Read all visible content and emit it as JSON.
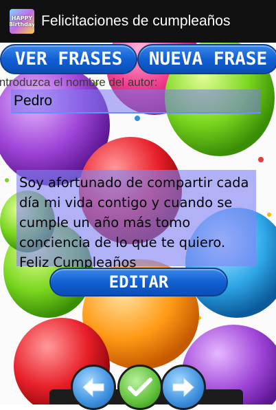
{
  "actionbar": {
    "title": "Felicitaciones de cumpleaños",
    "icon_text": "HAPPY Birthday"
  },
  "buttons": {
    "ver_frases": "VER FRASES",
    "nueva_frase": "NUEVA FRASE",
    "editar": "EDITAR"
  },
  "author": {
    "label": "Introduzca el nombre del autor:",
    "value": "Pedro"
  },
  "phrase": {
    "text": "Soy afortunado de compartir cada día mi vida contigo y cuando se cumple un año más tomo conciencia de lo que te quiero. Feliz Cumpleaños"
  },
  "nav": {
    "prev_icon": "arrow-left-icon",
    "ok_icon": "checkmark-icon",
    "next_icon": "arrow-right-icon"
  },
  "colors": {
    "button_blue": "#1160d3",
    "highlight_purple": "#8282f5",
    "actionbar_bg": "#111111"
  }
}
